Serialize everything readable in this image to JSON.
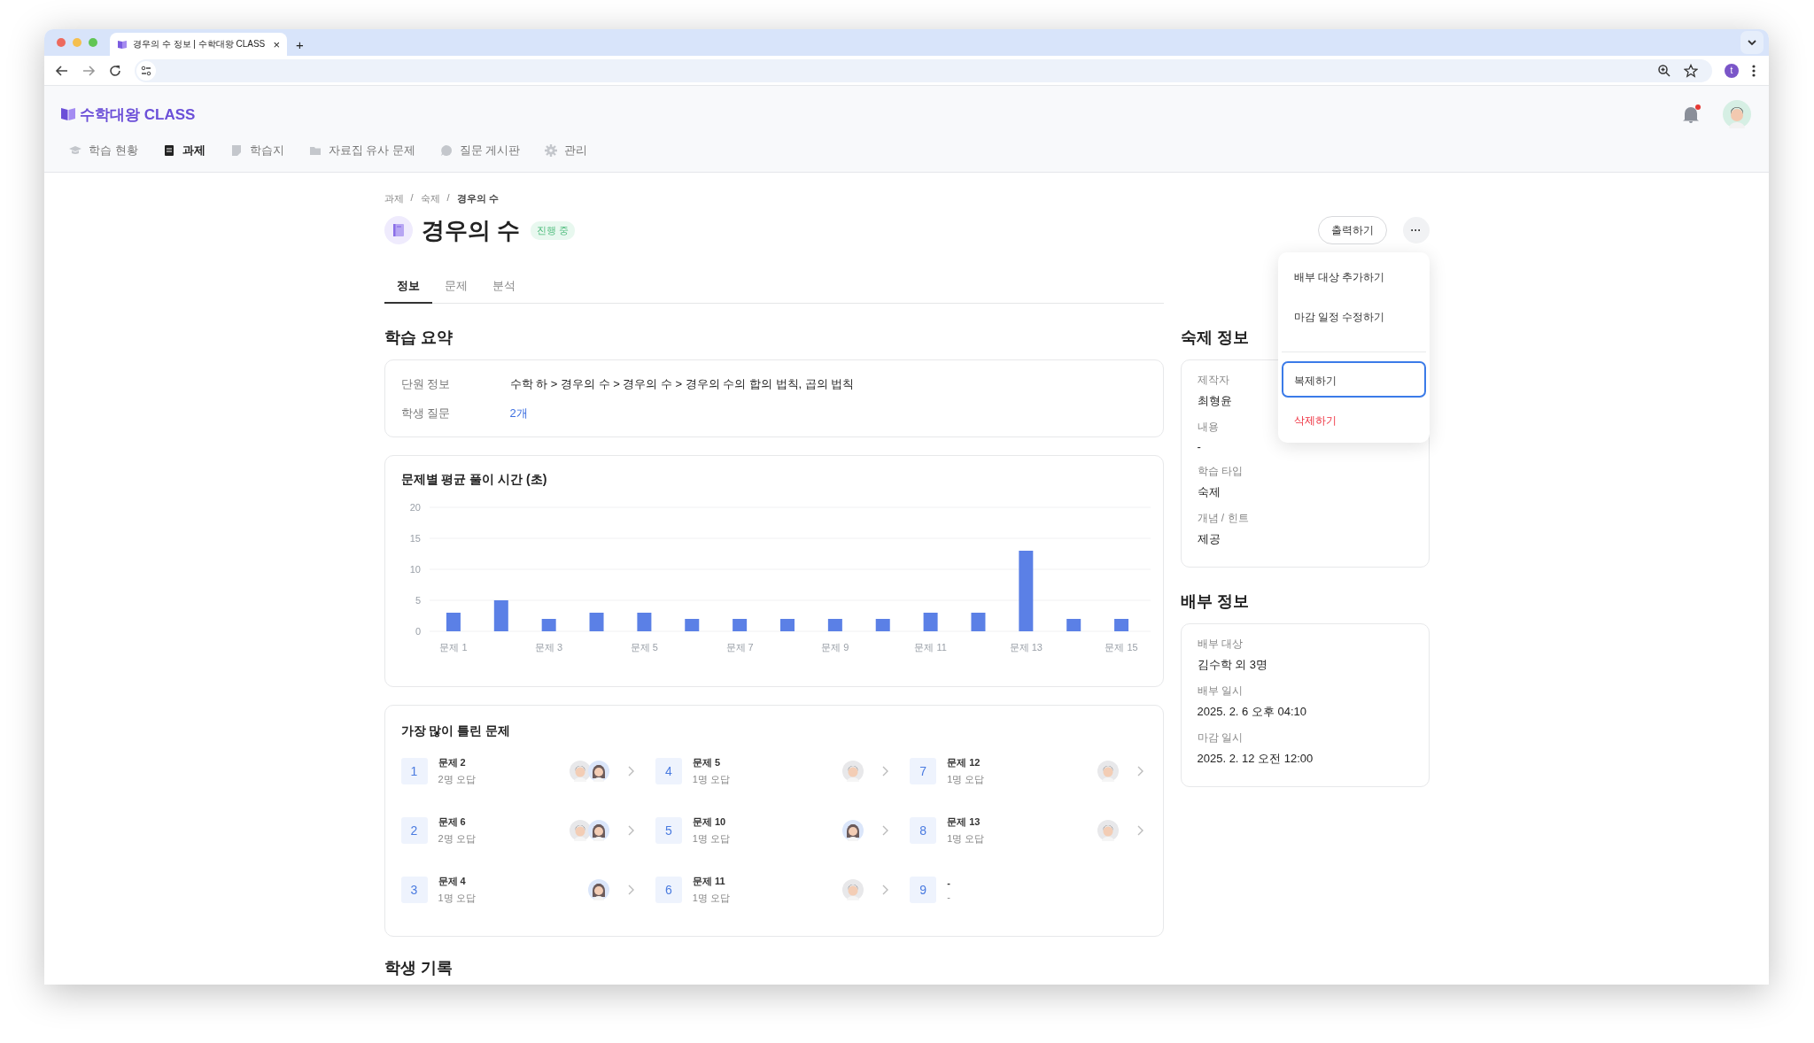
{
  "browser": {
    "tab_title": "경우의 수 정보 | 수학대왕 CLASS",
    "tab_close": "×",
    "new_tab": "+",
    "profile_initial": "t"
  },
  "header": {
    "logo": "수학대왕 CLASS",
    "notification_dot": true,
    "nav": [
      {
        "label": "학습 현황",
        "kind": "cap",
        "selected": false
      },
      {
        "label": "과제",
        "kind": "doc",
        "selected": true
      },
      {
        "label": "학습지",
        "kind": "note",
        "selected": false
      },
      {
        "label": "자료집 유사 문제",
        "kind": "folder",
        "selected": false
      },
      {
        "label": "질문 게시판",
        "kind": "question",
        "selected": false
      },
      {
        "label": "관리",
        "kind": "gear",
        "selected": false
      }
    ]
  },
  "breadcrumb": [
    "과제",
    "숙제",
    "경우의 수"
  ],
  "breadcrumb_separator": "/",
  "title": "경우의 수",
  "status": "진행 중",
  "print_button": "출력하기",
  "more_button": "···",
  "menu": {
    "groups": [
      [
        {
          "label": "배부 대상 추가하기",
          "kind": "normal",
          "focused": false
        },
        {
          "label": "마감 일정 수정하기",
          "kind": "normal",
          "focused": false
        }
      ],
      [
        {
          "label": "복제하기",
          "kind": "normal",
          "focused": true
        },
        {
          "label": "삭제하기",
          "kind": "danger",
          "focused": false
        }
      ]
    ]
  },
  "tabs": [
    {
      "label": "정보",
      "selected": true
    },
    {
      "label": "문제",
      "selected": false
    },
    {
      "label": "분석",
      "selected": false
    }
  ],
  "summary": {
    "heading": "학습 요약",
    "rows": [
      {
        "label": "단원 정보",
        "value": "수학 하 > 경우의 수 > 경우의 수 > 경우의 수의 합의 법칙, 곱의 법칙",
        "kind": "text"
      },
      {
        "label": "학생 질문",
        "value": "2개",
        "kind": "link"
      }
    ]
  },
  "time_chart": {
    "title": "문제별 평균 풀이 시간 (초)",
    "chart_data": {
      "type": "bar",
      "categories": [
        "문제 1",
        null,
        "문제 3",
        null,
        "문제 5",
        null,
        "문제 7",
        null,
        "문제 9",
        null,
        "문제 11",
        null,
        "문제 13",
        null,
        "문제 15"
      ],
      "series": [
        {
          "color": "#5b80e6",
          "values": [
            3,
            5,
            2,
            3,
            3,
            2,
            2,
            2,
            2,
            2,
            3,
            3,
            13,
            2,
            2
          ]
        }
      ],
      "ylim": [
        0,
        20
      ],
      "yticks": [
        0,
        5,
        10,
        15,
        20
      ],
      "grid": true
    }
  },
  "wrong": {
    "heading": "가장 많이 틀린 문제",
    "items": [
      {
        "rank": "1",
        "title": "문제 2",
        "sub": "2명 오답",
        "avatars": [
          {
            "kind": "boy"
          },
          {
            "kind": "girl"
          }
        ],
        "link": true
      },
      {
        "rank": "2",
        "title": "문제 6",
        "sub": "2명 오답",
        "avatars": [
          {
            "kind": "boy"
          },
          {
            "kind": "girl"
          }
        ],
        "link": true
      },
      {
        "rank": "3",
        "title": "문제 4",
        "sub": "1명 오답",
        "avatars": [
          {
            "kind": "girl"
          }
        ],
        "link": true
      },
      {
        "rank": "4",
        "title": "문제 5",
        "sub": "1명 오답",
        "avatars": [
          {
            "kind": "boy"
          }
        ],
        "link": true
      },
      {
        "rank": "5",
        "title": "문제 10",
        "sub": "1명 오답",
        "avatars": [
          {
            "kind": "girl"
          }
        ],
        "link": true
      },
      {
        "rank": "6",
        "title": "문제 11",
        "sub": "1명 오답",
        "avatars": [
          {
            "kind": "boy"
          }
        ],
        "link": true
      },
      {
        "rank": "7",
        "title": "문제 12",
        "sub": "1명 오답",
        "avatars": [
          {
            "kind": "boy"
          }
        ],
        "link": true
      },
      {
        "rank": "8",
        "title": "문제 13",
        "sub": "1명 오답",
        "avatars": [
          {
            "kind": "boy"
          }
        ],
        "link": true
      },
      {
        "rank": "9",
        "title": "-",
        "sub": "-",
        "link": false
      }
    ]
  },
  "records_heading": "학생 기록",
  "homework_info": {
    "heading": "숙제 정보",
    "fields": [
      {
        "label": "제작자",
        "value": "최형윤"
      },
      {
        "label": "내용",
        "value": "-"
      },
      {
        "label": "학습 타입",
        "value": "숙제"
      },
      {
        "label": "개념 / 힌트",
        "value": "제공"
      }
    ]
  },
  "distribution_info": {
    "heading": "배부 정보",
    "fields": [
      {
        "label": "배부 대상",
        "value": "김수학 외 3명"
      },
      {
        "label": "배부 일시",
        "value": "2025. 2. 6 오후 04:10"
      },
      {
        "label": "마감 일시",
        "value": "2025. 2. 12 오전 12:00"
      }
    ]
  }
}
